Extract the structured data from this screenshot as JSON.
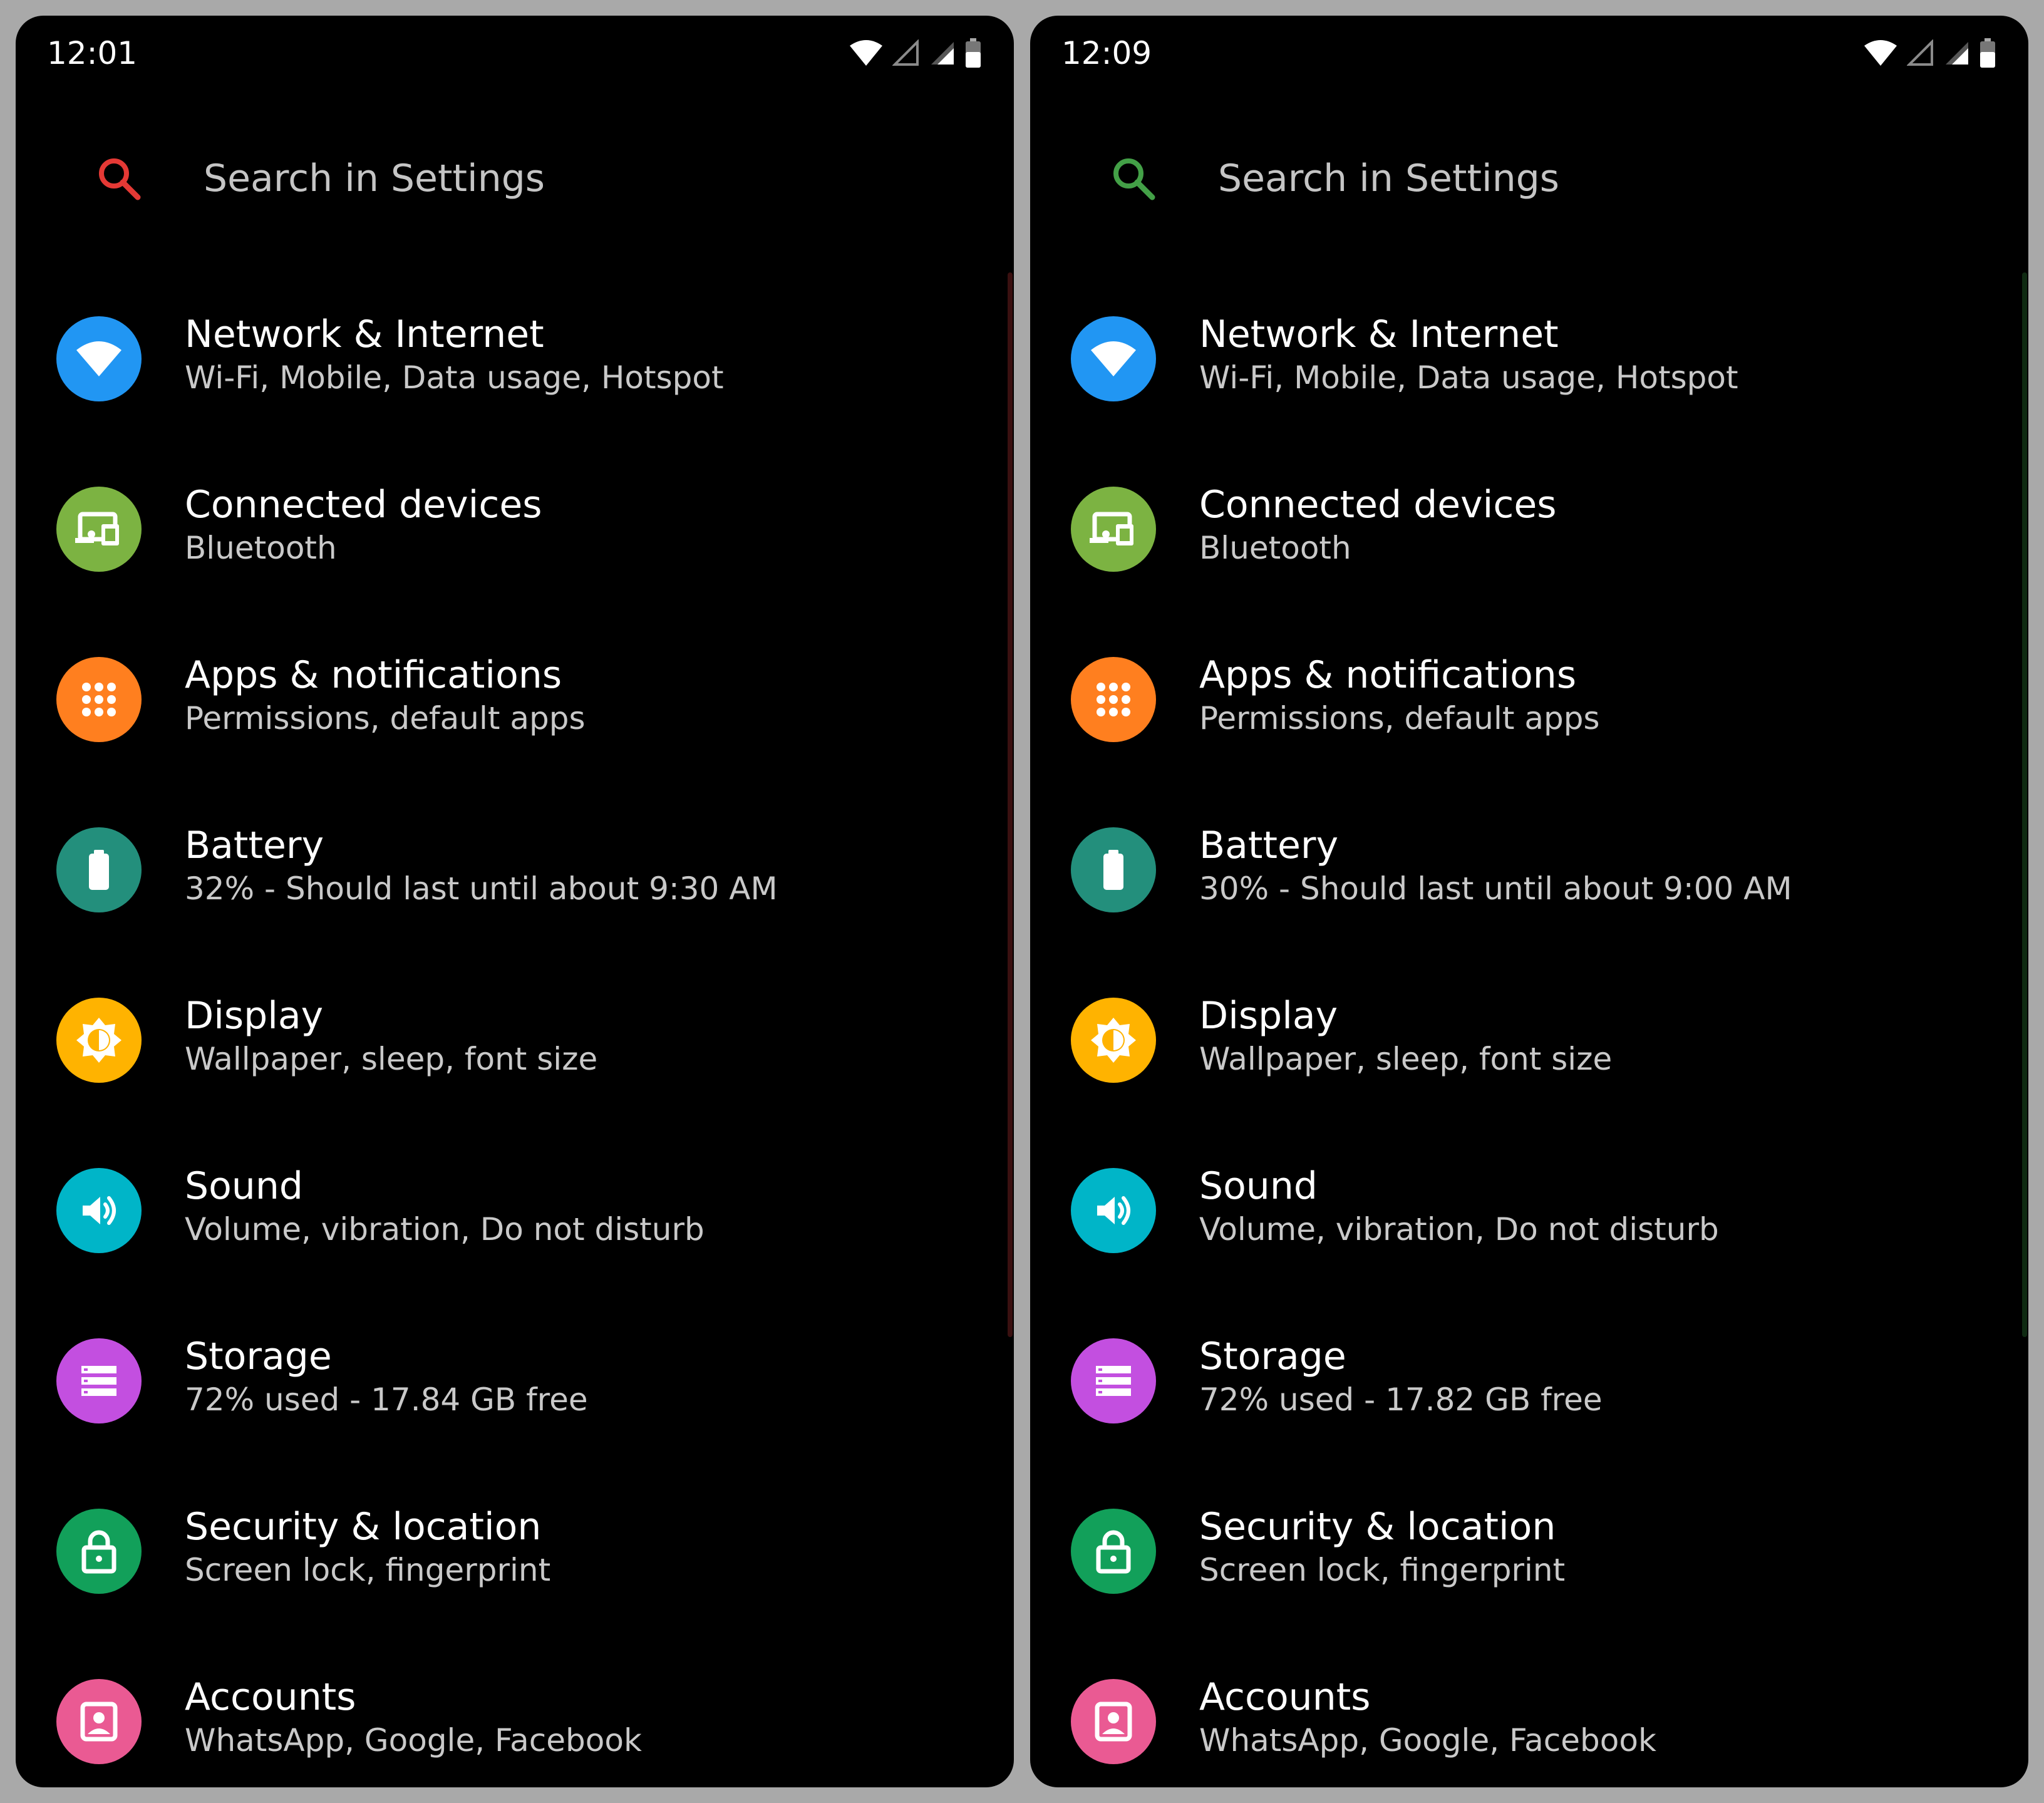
{
  "left": {
    "status": {
      "time": "12:01"
    },
    "search": {
      "placeholder": "Search in Settings",
      "icon_color": "#e53935"
    },
    "scroll_color": "#3a1010",
    "items": [
      {
        "icon": "wifi-icon",
        "color": "#2196f3",
        "title": "Network & Internet",
        "subtitle": "Wi-Fi, Mobile, Data usage, Hotspot"
      },
      {
        "icon": "devices-icon",
        "color": "#7cb342",
        "title": "Connected devices",
        "subtitle": "Bluetooth"
      },
      {
        "icon": "apps-grid-icon",
        "color": "#ff7f1f",
        "title": "Apps & notifications",
        "subtitle": "Permissions, default apps"
      },
      {
        "icon": "battery-icon",
        "color": "#238f7c",
        "title": "Battery",
        "subtitle": "32% - Should last until about 9:30 AM"
      },
      {
        "icon": "brightness-icon",
        "color": "#ffb300",
        "title": "Display",
        "subtitle": "Wallpaper, sleep, font size"
      },
      {
        "icon": "volume-icon",
        "color": "#00b5c8",
        "title": "Sound",
        "subtitle": "Volume, vibration, Do not disturb"
      },
      {
        "icon": "storage-icon",
        "color": "#c34fe0",
        "title": "Storage",
        "subtitle": "72% used - 17.84 GB free"
      },
      {
        "icon": "lock-icon",
        "color": "#12a05a",
        "title": "Security & location",
        "subtitle": "Screen lock, fingerprint"
      },
      {
        "icon": "account-icon",
        "color": "#ea5a93",
        "title": "Accounts",
        "subtitle": "WhatsApp, Google, Facebook"
      }
    ]
  },
  "right": {
    "status": {
      "time": "12:09"
    },
    "search": {
      "placeholder": "Search in Settings",
      "icon_color": "#43a047"
    },
    "scroll_color": "#0f2a12",
    "items": [
      {
        "icon": "wifi-icon",
        "color": "#2196f3",
        "title": "Network & Internet",
        "subtitle": "Wi-Fi, Mobile, Data usage, Hotspot"
      },
      {
        "icon": "devices-icon",
        "color": "#7cb342",
        "title": "Connected devices",
        "subtitle": "Bluetooth"
      },
      {
        "icon": "apps-grid-icon",
        "color": "#ff7f1f",
        "title": "Apps & notifications",
        "subtitle": "Permissions, default apps"
      },
      {
        "icon": "battery-icon",
        "color": "#238f7c",
        "title": "Battery",
        "subtitle": "30% - Should last until about 9:00 AM"
      },
      {
        "icon": "brightness-icon",
        "color": "#ffb300",
        "title": "Display",
        "subtitle": "Wallpaper, sleep, font size"
      },
      {
        "icon": "volume-icon",
        "color": "#00b5c8",
        "title": "Sound",
        "subtitle": "Volume, vibration, Do not disturb"
      },
      {
        "icon": "storage-icon",
        "color": "#c34fe0",
        "title": "Storage",
        "subtitle": "72% used - 17.82 GB free"
      },
      {
        "icon": "lock-icon",
        "color": "#12a05a",
        "title": "Security & location",
        "subtitle": "Screen lock, fingerprint"
      },
      {
        "icon": "account-icon",
        "color": "#ea5a93",
        "title": "Accounts",
        "subtitle": "WhatsApp, Google, Facebook"
      }
    ]
  }
}
